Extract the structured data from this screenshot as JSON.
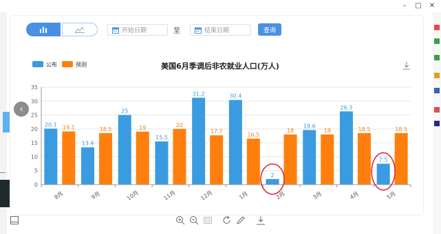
{
  "window": {
    "min_glyph": "–",
    "max_glyph": "□",
    "close_glyph": "✕"
  },
  "toolbar": {
    "bar_icon": "bar-chart-icon",
    "line_icon": "line-chart-icon",
    "start_placeholder": "开始日期",
    "to_label": "至",
    "end_placeholder": "结束日期",
    "query_label": "查询",
    "accent": "#4a90e2"
  },
  "chart_data": {
    "type": "bar",
    "title": "美国6月季调后非农就业人口(万人)",
    "categories": [
      "8月",
      "9月",
      "10月",
      "11月",
      "12月",
      "1月",
      "2月",
      "3月",
      "4月",
      "5月"
    ],
    "series": [
      {
        "name": "公布",
        "color": "#3a9be0",
        "values": [
          20.1,
          13.4,
          25,
          15.5,
          31.2,
          30.4,
          2,
          19.6,
          26.3,
          7.5
        ]
      },
      {
        "name": "预测",
        "color": "#ff7f0e",
        "values": [
          19.1,
          18.5,
          19,
          20,
          17.7,
          16.5,
          18,
          18,
          18.5,
          18.5
        ]
      }
    ],
    "data_labels": [
      [
        "20.1",
        "13.4",
        "25",
        "15.5",
        "31.2",
        "30.4",
        "2",
        "19.6",
        "26.3",
        "7.5"
      ],
      [
        "19.1",
        "18.5",
        "19",
        "20",
        "17.7",
        "16.5",
        "18",
        "18",
        "18.5",
        "18.5"
      ]
    ],
    "ylim": [
      0,
      35
    ],
    "yticks": [
      "0",
      "5",
      "10",
      "15",
      "20",
      "25",
      "30",
      "35"
    ],
    "grid": true,
    "legend": "top-left",
    "highlight_circles": [
      "2月 公布",
      "5月 公布"
    ],
    "highlight_color": "#e02030"
  },
  "icons": {
    "prev": "chevron-left-icon",
    "download": "download-icon",
    "zoom_in": "zoom-in-icon",
    "zoom_out": "zoom-out-icon",
    "zoom_reset": "zoom-reset-icon",
    "rotate": "refresh-icon",
    "edit": "pencil-icon",
    "save": "download-icon",
    "side": "panel-icon"
  },
  "arrow_glyph": "‹"
}
